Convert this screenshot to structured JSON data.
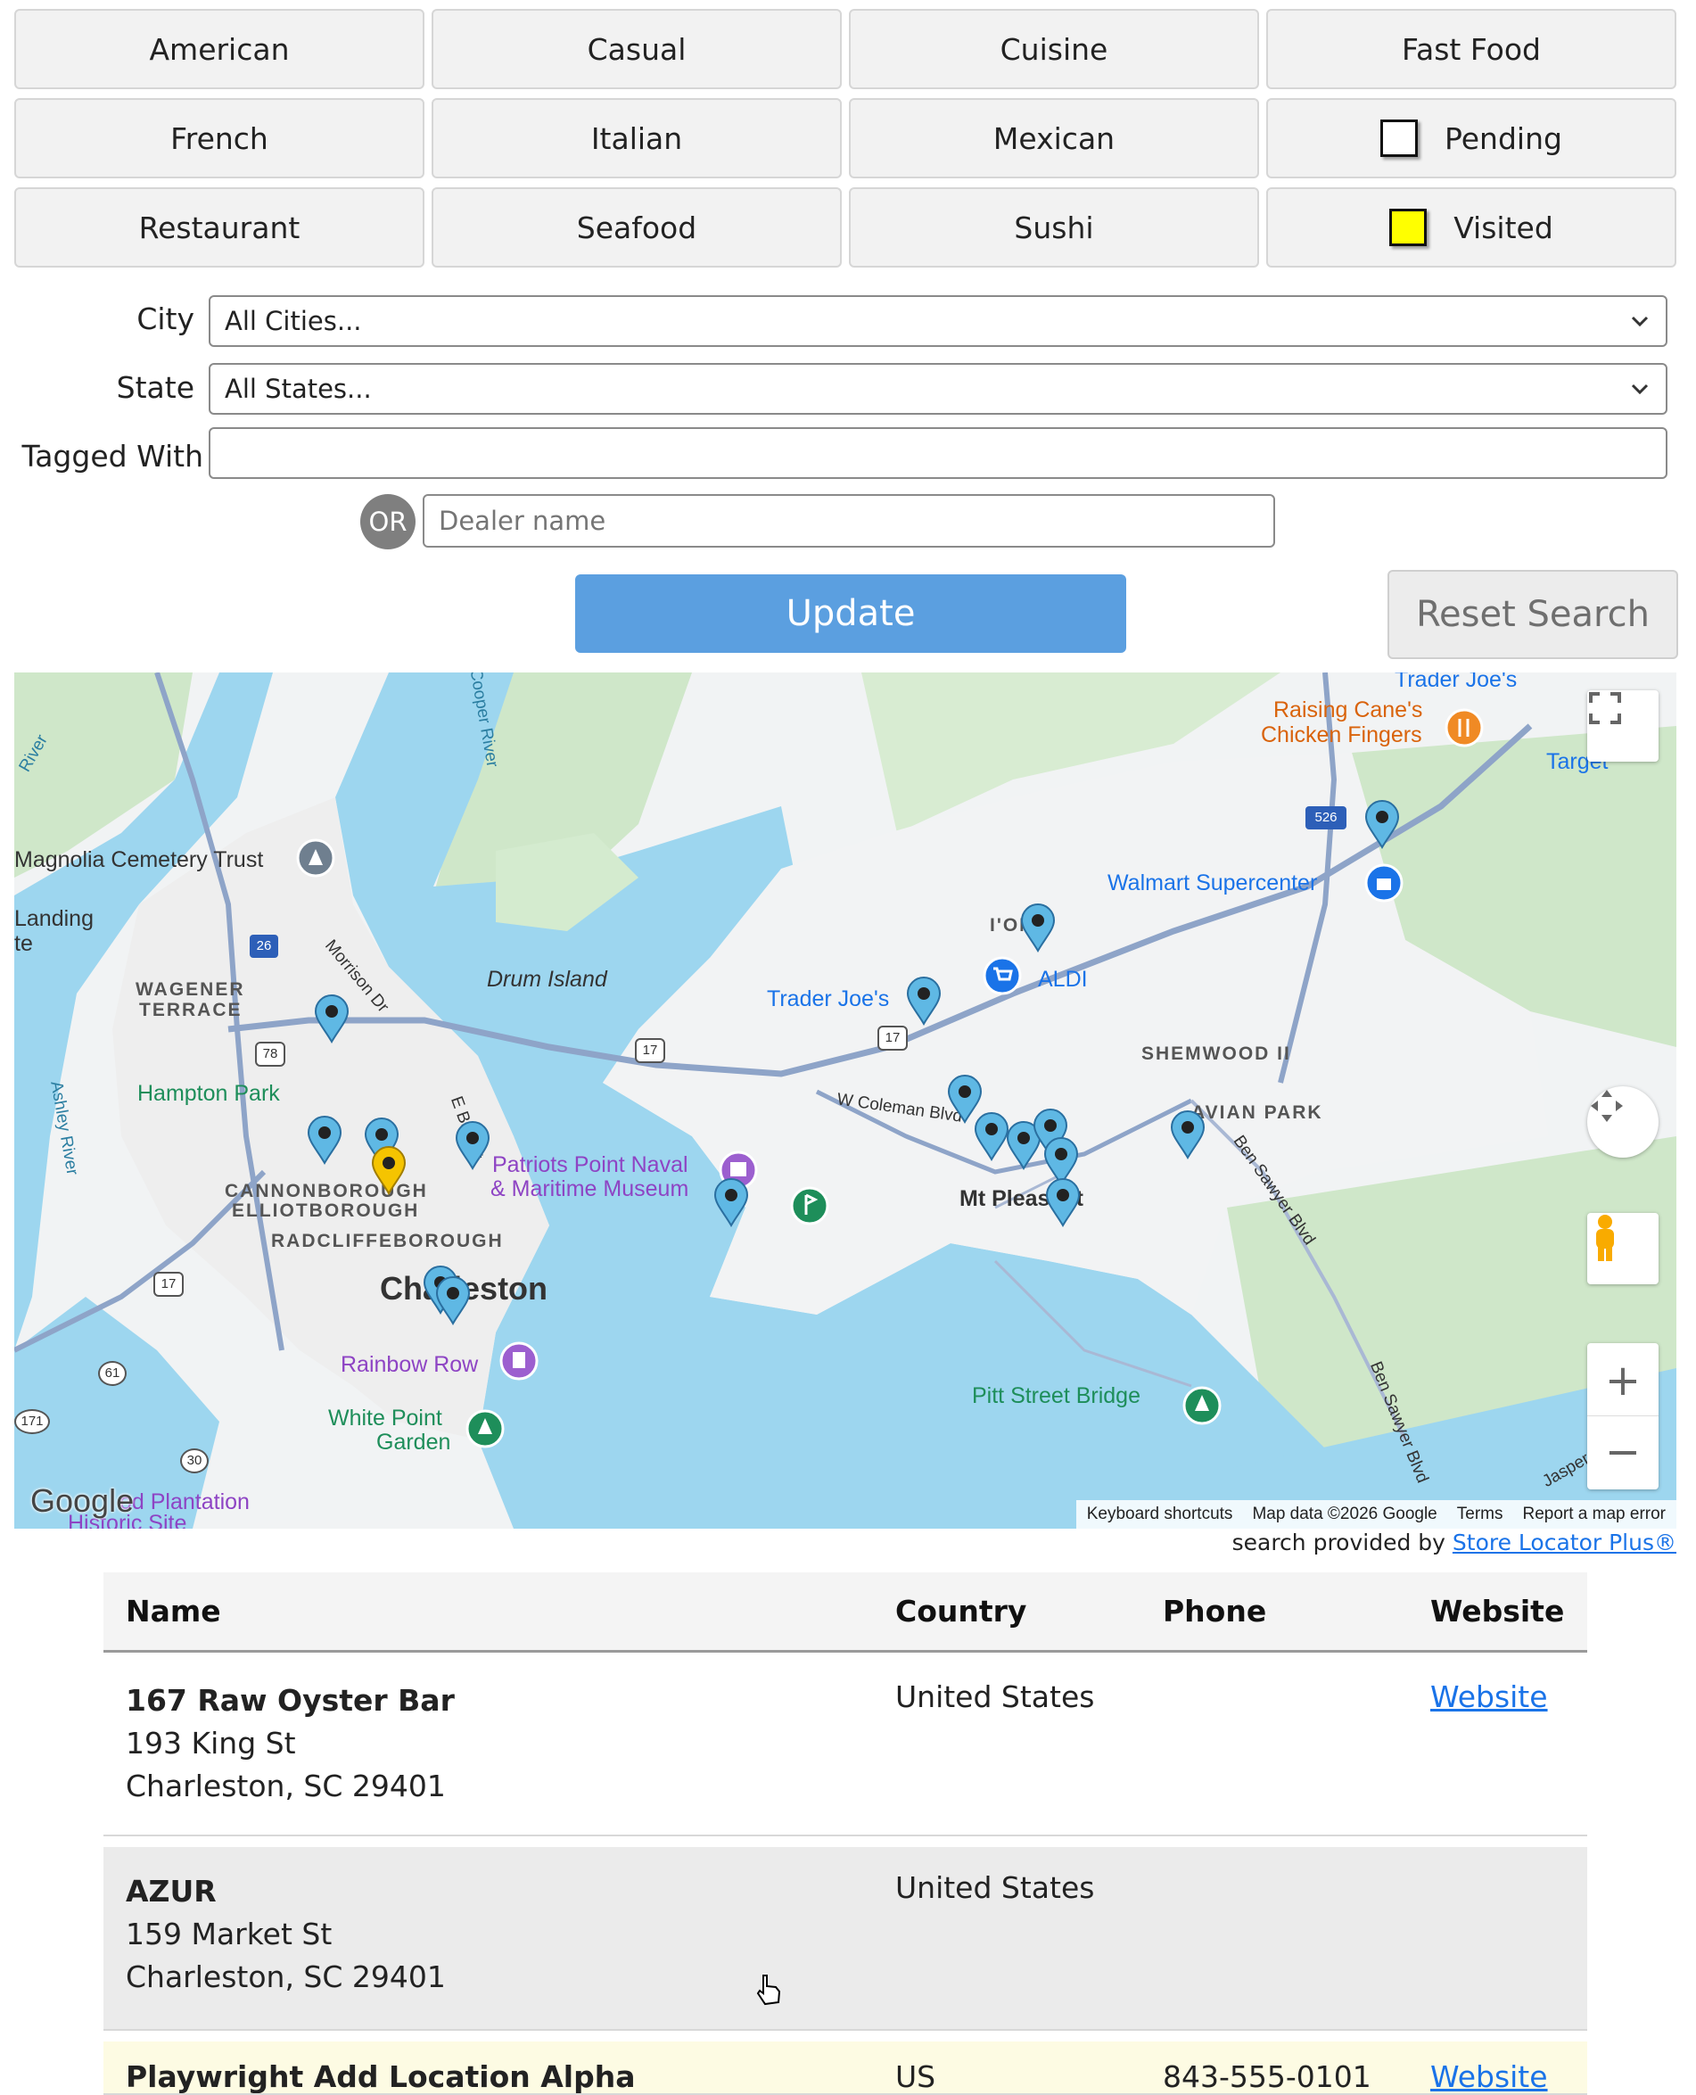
{
  "filters": {
    "row1": [
      "American",
      "Casual",
      "Cuisine",
      "Fast Food"
    ],
    "row2": [
      "French",
      "Italian",
      "Mexican"
    ],
    "pending_label": "Pending",
    "row3": [
      "Restaurant",
      "Seafood",
      "Sushi"
    ],
    "visited_label": "Visited",
    "visited_color": "#ffff00"
  },
  "form": {
    "city_label": "City",
    "city_value": "All Cities...",
    "state_label": "State",
    "state_value": "All States...",
    "tagged_label": "Tagged With",
    "tagged_value": "",
    "or_label": "OR",
    "dealer_placeholder": "Dealer name",
    "update_label": "Update",
    "reset_label": "Reset Search"
  },
  "map": {
    "labels": {
      "magnolia": "Magnolia Cemetery Trust",
      "landing": "Landing",
      "te": "te",
      "wagener": "WAGENER",
      "terrace": "TERRACE",
      "hampton": "Hampton Park",
      "cannonborough": "CANNONBOROUGH",
      "elliotborough": "ELLIOTBOROUGH",
      "radcliffe": "RADCLIFFEBOROUGH",
      "charleston": "Charleston",
      "rainbow": "Rainbow Row",
      "whitepoint1": "White Point",
      "whitepoint2": "Garden",
      "plantation": "od Plantation",
      "historic": "Historic Site",
      "drum": "Drum Island",
      "cooper": "Cooper River",
      "ashley": "Ashley River",
      "river_left": "River",
      "morrison": "Morrison Dr",
      "elbay": "E Bay St",
      "patriots1": "Patriots Point Naval",
      "patriots2": "& Maritime Museum",
      "traderjoes": "Trader Joe's",
      "traderjoes_top": "Trader Joe's",
      "aldi": "ALDI",
      "ion": "I'ON",
      "shemwood": "SHEMWOOD II",
      "avian": "AVIAN PARK",
      "coleman": "W Coleman Blvd",
      "mtp": "Mt Pleasant",
      "bensawyer": "Ben Sawyer Blvd",
      "bensawyer2": "Ben Sawyer Blvd",
      "pitt": "Pitt Street Bridge",
      "raising1": "Raising Cane's",
      "raising2": "Chicken Fingers",
      "target": "Target",
      "walmart": "Walmart Supercenter",
      "jasper": "Jasper",
      "shield_26": "26",
      "shield_78": "78",
      "shield_17a": "17",
      "shield_17b": "17",
      "shield_17c": "17",
      "shield_526": "526",
      "shield_61": "61",
      "shield_171": "171",
      "shield_30": "30"
    },
    "google": "Google",
    "keyboard": "Keyboard shortcuts",
    "mapdata": "Map data ©2026 Google",
    "terms": "Terms",
    "report": "Report a map error",
    "zoom_in": "+",
    "zoom_out": "−"
  },
  "powered": {
    "prefix": "search provided by",
    "link": "Store Locator Plus®"
  },
  "results": {
    "headers": [
      "Name",
      "Country",
      "Phone",
      "Website"
    ],
    "rows": [
      {
        "name": "167 Raw Oyster Bar",
        "addr1": "193 King St",
        "addr2": "Charleston, SC 29401",
        "country": "United States",
        "phone": "",
        "website": "Website"
      },
      {
        "name": "AZUR",
        "addr1": "159 Market St",
        "addr2": "Charleston, SC 29401",
        "country": "United States",
        "phone": "",
        "website": ""
      },
      {
        "name": "Playwright Add Location Alpha",
        "country": "US",
        "phone": "843-555-0101",
        "website": "Website"
      }
    ]
  }
}
